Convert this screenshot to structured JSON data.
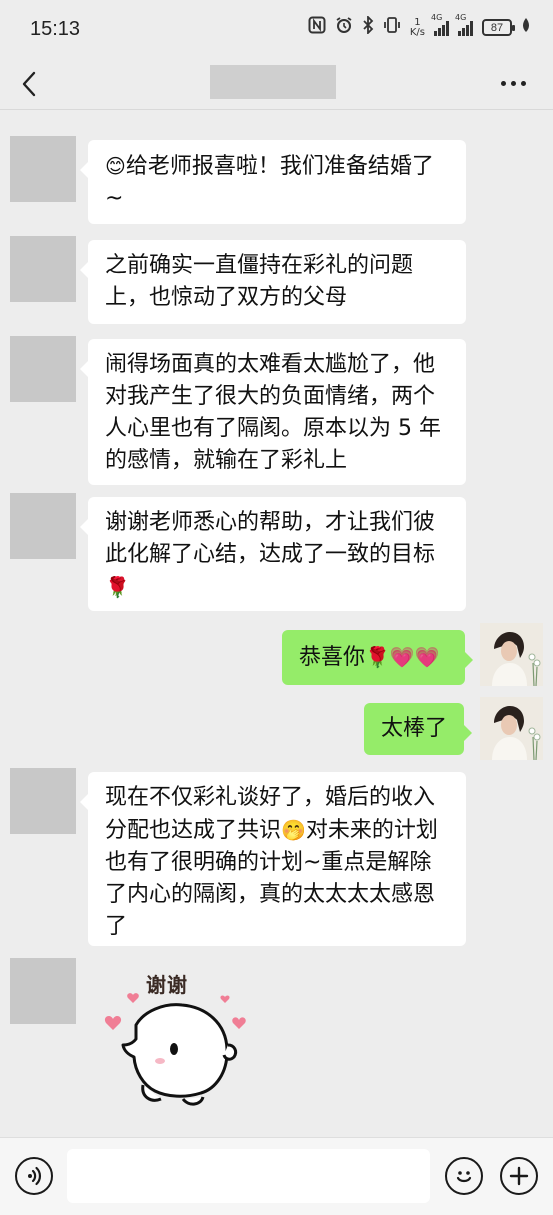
{
  "status_bar": {
    "time": "15:13",
    "net_speed_value": "1",
    "net_speed_unit": "K/s",
    "signal_1_label": "4G",
    "signal_2_label": "4G",
    "battery": "87"
  },
  "nav": {
    "title": ""
  },
  "messages": [
    {
      "side": "left",
      "emoji": "😊",
      "text": "给老师报喜啦！我们准备结婚了~"
    },
    {
      "side": "left",
      "text": "之前确实一直僵持在彩礼的问题上，也惊动了双方的父母"
    },
    {
      "side": "left",
      "text": "闹得场面真的太难看太尴尬了，他对我产生了很大的负面情绪，两个人心里也有了隔阂。原本以为 5 年的感情，就输在了彩礼上"
    },
    {
      "side": "left",
      "text": "谢谢老师悉心的帮助，才让我们彼此化解了心结，达成了一致的目标",
      "emoji_after": "🌹"
    },
    {
      "side": "right",
      "text": "恭喜你",
      "emoji_after": "🌹💗💗"
    },
    {
      "side": "right",
      "text": "太棒了"
    },
    {
      "side": "left",
      "text_part1": "现在不仅彩礼谈好了，婚后的收入分配也达成了共识",
      "emoji_mid": "🤭",
      "text_part2": "对未来的计划也有了很明确的计划~重点是解除了内心的隔阂，真的太太太太感恩了"
    }
  ],
  "sticker": {
    "text": "谢谢",
    "icon": "cute-bun-thank-you-sticker"
  },
  "input_bar": {
    "placeholder": "",
    "voice_icon": "voice-icon",
    "emoji_icon": "emoji-icon",
    "plus_icon": "plus-icon"
  },
  "colors": {
    "background": "#ededed",
    "bubble_left": "#ffffff",
    "bubble_right": "#95ec69",
    "redacted": "#c8c8c8"
  }
}
